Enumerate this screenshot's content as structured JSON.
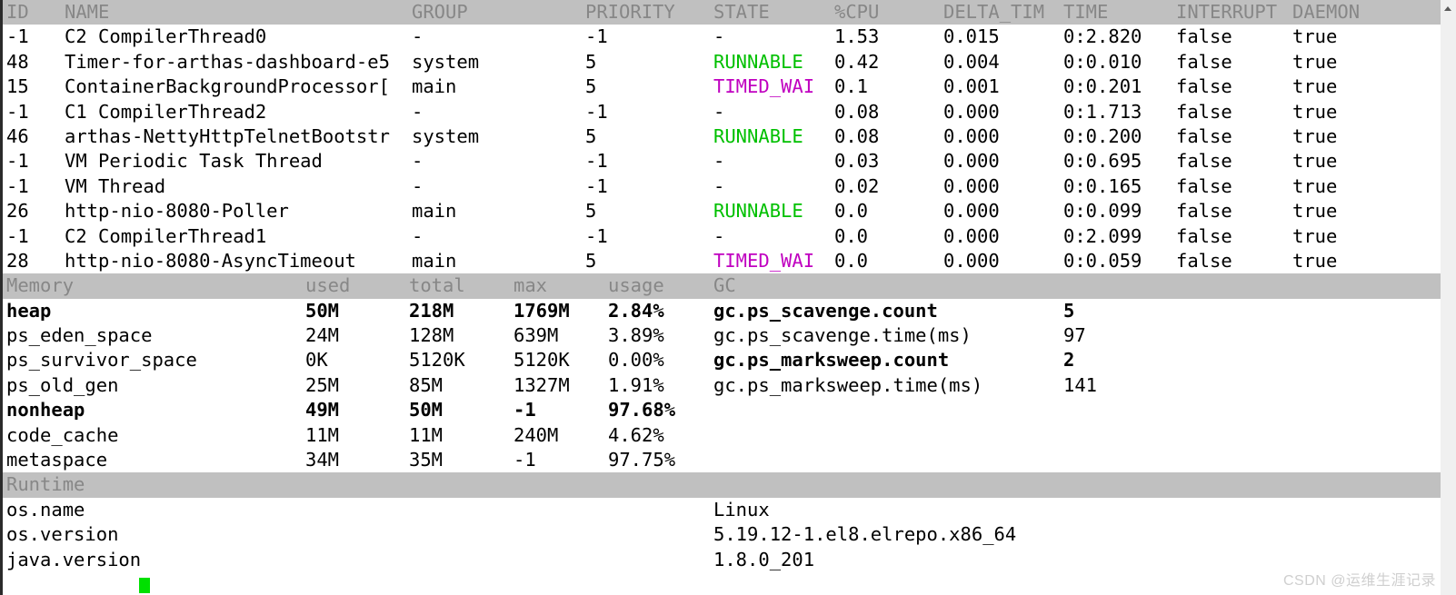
{
  "threads_table": {
    "columns": [
      "ID",
      "NAME",
      "GROUP",
      "PRIORITY",
      "STATE",
      "%CPU",
      "DELTA_TIM",
      "TIME",
      "INTERRUPT",
      "DAEMON"
    ],
    "rows": [
      {
        "id": "-1",
        "name": "C2 CompilerThread0",
        "group": "-",
        "priority": "-1",
        "state": "-",
        "state_color": "default",
        "cpu": "1.53",
        "delta_time": "0.015",
        "time": "0:2.820",
        "interrupt": "false",
        "daemon": "true"
      },
      {
        "id": "48",
        "name": "Timer-for-arthas-dashboard-e5",
        "group": "system",
        "priority": "5",
        "state": "RUNNABLE",
        "state_color": "green",
        "cpu": "0.42",
        "delta_time": "0.004",
        "time": "0:0.010",
        "interrupt": "false",
        "daemon": "true"
      },
      {
        "id": "15",
        "name": "ContainerBackgroundProcessor[",
        "group": "main",
        "priority": "5",
        "state": "TIMED_WAI",
        "state_color": "magenta",
        "cpu": "0.1",
        "delta_time": "0.001",
        "time": "0:0.201",
        "interrupt": "false",
        "daemon": "true"
      },
      {
        "id": "-1",
        "name": "C1 CompilerThread2",
        "group": "-",
        "priority": "-1",
        "state": "-",
        "state_color": "default",
        "cpu": "0.08",
        "delta_time": "0.000",
        "time": "0:1.713",
        "interrupt": "false",
        "daemon": "true"
      },
      {
        "id": "46",
        "name": "arthas-NettyHttpTelnetBootstr",
        "group": "system",
        "priority": "5",
        "state": "RUNNABLE",
        "state_color": "green",
        "cpu": "0.08",
        "delta_time": "0.000",
        "time": "0:0.200",
        "interrupt": "false",
        "daemon": "true"
      },
      {
        "id": "-1",
        "name": "VM Periodic Task Thread",
        "group": "-",
        "priority": "-1",
        "state": "-",
        "state_color": "default",
        "cpu": "0.03",
        "delta_time": "0.000",
        "time": "0:0.695",
        "interrupt": "false",
        "daemon": "true"
      },
      {
        "id": "-1",
        "name": "VM Thread",
        "group": "-",
        "priority": "-1",
        "state": "-",
        "state_color": "default",
        "cpu": "0.02",
        "delta_time": "0.000",
        "time": "0:0.165",
        "interrupt": "false",
        "daemon": "true"
      },
      {
        "id": "26",
        "name": "http-nio-8080-Poller",
        "group": "main",
        "priority": "5",
        "state": "RUNNABLE",
        "state_color": "green",
        "cpu": "0.0",
        "delta_time": "0.000",
        "time": "0:0.099",
        "interrupt": "false",
        "daemon": "true"
      },
      {
        "id": "-1",
        "name": "C2 CompilerThread1",
        "group": "-",
        "priority": "-1",
        "state": "-",
        "state_color": "default",
        "cpu": "0.0",
        "delta_time": "0.000",
        "time": "0:2.099",
        "interrupt": "false",
        "daemon": "true"
      },
      {
        "id": "28",
        "name": "http-nio-8080-AsyncTimeout",
        "group": "main",
        "priority": "5",
        "state": "TIMED_WAI",
        "state_color": "magenta",
        "cpu": "0.0",
        "delta_time": "0.000",
        "time": "0:0.059",
        "interrupt": "false",
        "daemon": "true"
      }
    ]
  },
  "memory_table": {
    "columns": [
      "Memory",
      "used",
      "total",
      "max",
      "usage"
    ],
    "rows": [
      {
        "name": "heap",
        "used": "50M",
        "total": "218M",
        "max": "1769M",
        "usage": "2.84%",
        "bold": true
      },
      {
        "name": "ps_eden_space",
        "used": "24M",
        "total": "128M",
        "max": "639M",
        "usage": "3.89%",
        "bold": false
      },
      {
        "name": "ps_survivor_space",
        "used": "0K",
        "total": "5120K",
        "max": "5120K",
        "usage": "0.00%",
        "bold": false
      },
      {
        "name": "ps_old_gen",
        "used": "25M",
        "total": "85M",
        "max": "1327M",
        "usage": "1.91%",
        "bold": false
      },
      {
        "name": "nonheap",
        "used": "49M",
        "total": "50M",
        "max": "-1",
        "usage": "97.68%",
        "bold": true
      },
      {
        "name": "code_cache",
        "used": "11M",
        "total": "11M",
        "max": "240M",
        "usage": "4.62%",
        "bold": false
      },
      {
        "name": "metaspace",
        "used": "34M",
        "total": "35M",
        "max": "-1",
        "usage": "97.75%",
        "bold": false
      }
    ]
  },
  "gc_table": {
    "column": "GC",
    "rows": [
      {
        "name": "gc.ps_scavenge.count",
        "value": "5",
        "bold": true
      },
      {
        "name": "gc.ps_scavenge.time(ms)",
        "value": "97",
        "bold": false
      },
      {
        "name": "gc.ps_marksweep.count",
        "value": "2",
        "bold": true
      },
      {
        "name": "gc.ps_marksweep.time(ms)",
        "value": "141",
        "bold": false
      }
    ]
  },
  "runtime_table": {
    "column": "Runtime",
    "rows": [
      {
        "name": "os.name",
        "value": "Linux"
      },
      {
        "name": "os.version",
        "value": "5.19.12-1.el8.elrepo.x86_64"
      },
      {
        "name": "java.version",
        "value": "1.8.0_201"
      }
    ]
  },
  "scrollbar": {
    "up_arrow": "scroll-up-arrow"
  },
  "watermark": {
    "text": "CSDN @运维生涯记录"
  },
  "colors": {
    "header_background": "#c0c0c0",
    "header_text": "#878787",
    "body_text": "#000000",
    "state_runnable": "#00c000",
    "state_timed_waiting": "#c000c0",
    "cursor": "#00e000",
    "terminal_background": "#ffffff"
  }
}
